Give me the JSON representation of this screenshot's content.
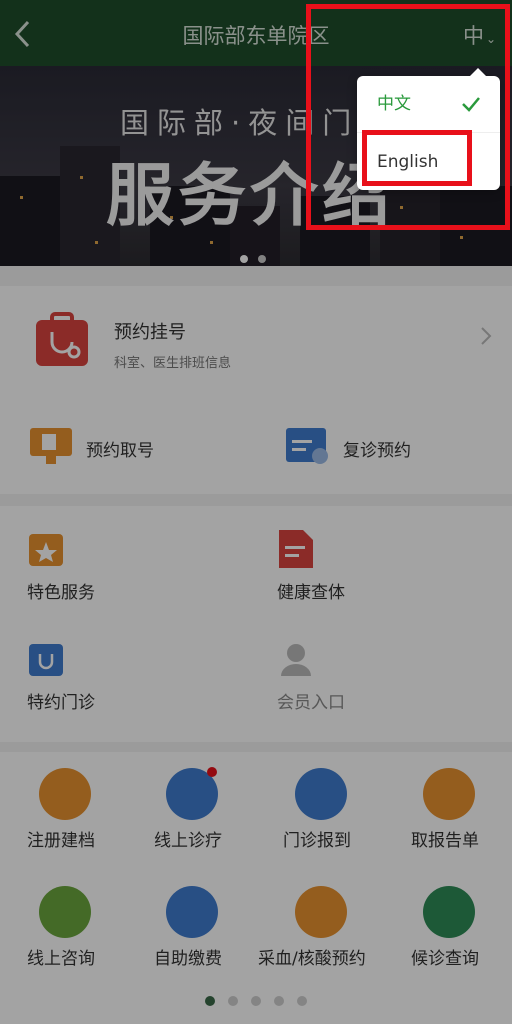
{
  "header": {
    "title": "国际部东单院区",
    "lang_current": "中",
    "lang_caret": "⌄"
  },
  "banner": {
    "subtitle": "国际部·夜间门",
    "main_title": "服务介绍"
  },
  "card1": {
    "title": "预约挂号",
    "subtitle": "科室、医生排班信息"
  },
  "card1_row": {
    "left": "预约取号",
    "right": "复诊预约"
  },
  "grid1": {
    "a": "特色服务",
    "b": "健康查体",
    "c": "特约门诊",
    "d": "会员入口"
  },
  "grid2": [
    "注册建档",
    "线上诊疗",
    "门诊报到",
    "取报告单",
    "线上咨询",
    "自助缴费",
    "采血/核酸预约",
    "候诊查询"
  ],
  "menu": {
    "items": [
      "中文",
      "English"
    ],
    "selected": "中文"
  },
  "colors": {
    "header": "#1e4d2b",
    "accent": "#2a9a3c",
    "highlight": "#e8101a"
  }
}
